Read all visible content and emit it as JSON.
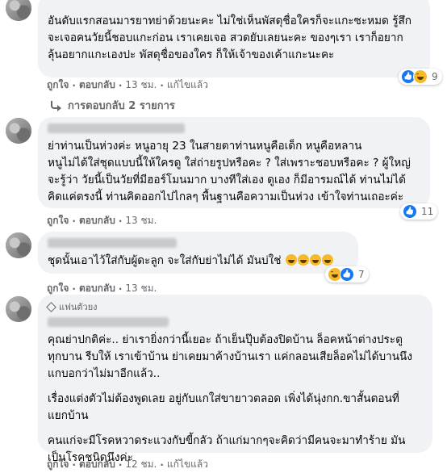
{
  "comments": [
    {
      "text": "อันดับแรกสอนมารยาทย่าด้วยนะคะ ไม่ใช่เห็นพัสดุชื่อใครก็จะแกะซะหมด รู้สึก\nจะเจอคนวัยนี้ชอบแกะก่อน เราเคยเจอ สวดยับเลยนะคะ ของๆเรา เราก็อยาก\nลุ้นอยากแกะเองปะ พัสดุชื่อของใคร ก็ให้เจ้าของเค้าแกะนะคะ",
      "like": "ถูกใจ",
      "reply": "ตอบกลับ",
      "time": "13 ชม.",
      "edited": "แก้ไขแล้ว",
      "reaction_count": "9"
    },
    {
      "text": "ย่าท่านเป็นห่วงค่ะ หนูอายุ 23 ในสายตาท่านหนูคือเด็ก หนูคือหลาน\nหนูไม่ได้ใส่ชุดแบบนี้ให้ใครดู ใส่ถ่ายรูปหรือคะ ? ใส่เพราะชอบหรือคะ ? ผู้ใหญ่\nจะรู้ว่า วัยนี้เป็นวัยที่มีฮอร์โมนมาก บางทีใส่เอง ดูเอง ก็มีอารมณ์ได้ ท่านไม่ได้\nคิดแค่ตรงนี้ ท่านคิดออกไปไกลๆ พื้นฐานคือความเป็นห่วง เข้าใจท่านเถอะค่ะ",
      "like": "ถูกใจ",
      "reply": "ตอบกลับ",
      "time": "13 ชม.",
      "reaction_count": "11"
    },
    {
      "text": "ชุดนั้นเอาไว้ใส่กับผู้ดะลูก จะใส่กับย่าไม่ได้ มันบ่ใช่",
      "like": "ถูกใจ",
      "reply": "ตอบกลับ",
      "time": "13 ชม.",
      "reaction_count": "7"
    },
    {
      "badge": "แฟนตัวยง",
      "paragraphs": [
        "คุณย่าปกติค่ะ.. ย่าเรายิ่งกว่านี้เยอะ ถ้าเย็นปุ๊บต้องปิดบ้าน ล็อคหน้าต่างประตู\nทุกบาน รีบให้ เราเข้าบ้าน ย่าเคยมาค้างบ้านเรา แค่กลอนเสียล็อคไม่ได้บานนึง\nแกบอกว่าไม่มาอีกแล้ว..",
        "เรื่องแต่งตัวไม่ต้องพูดเลย อยู่กับแกใส่ขายาวตลอด เพิ่งได้นุ่งกก.ขาสั้นตอนที่\nแยกบ้าน",
        "คนแก่จะมีโรคหวาดระแวงกับขี้กลัว ถ้าแก่มากๆจะคิดว่ามีคนจะมาทำร้าย มัน\nเป็นโรคชนิดนึงค่ะ"
      ],
      "like": "ถูกใจ",
      "reply": "ตอบกลับ",
      "time": "12 ชม.",
      "edited": "แก้ไขแล้ว"
    }
  ],
  "view_replies": "การตอบกลับ 2 รายการ",
  "sep": "·",
  "colors": {
    "bubble": "#f0f2f5",
    "meta": "#65676b",
    "like_blue": "#1877f2",
    "haha_yellow": "#f7b928"
  }
}
